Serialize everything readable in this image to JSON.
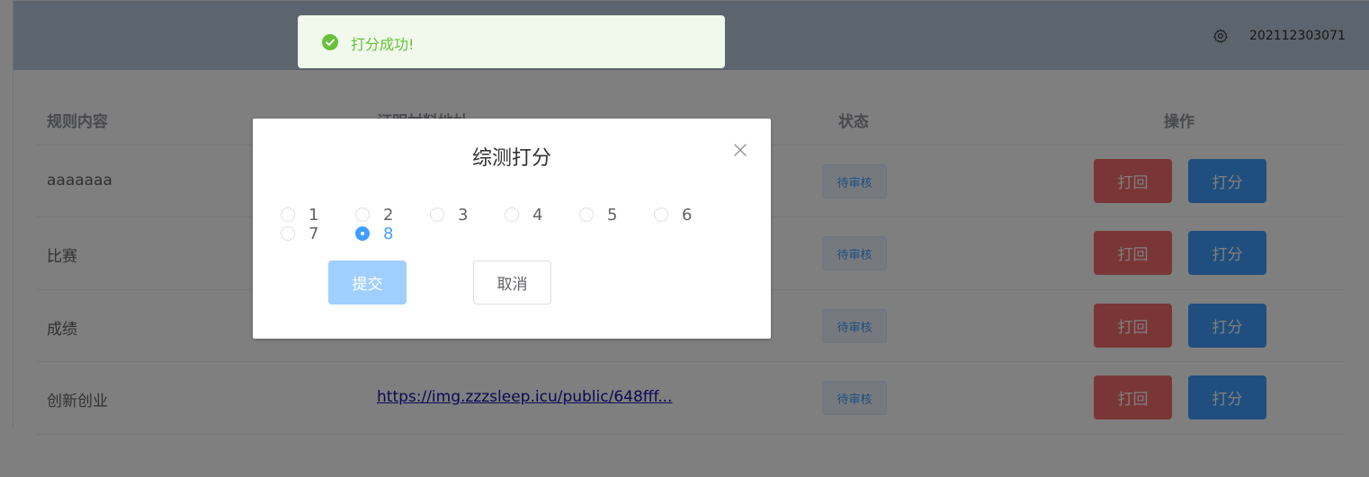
{
  "header": {
    "user_id": "202112303071",
    "settings_icon": "gear-icon"
  },
  "table": {
    "headers": [
      "规则内容",
      "证明材料地址",
      "状态",
      "操作"
    ],
    "rows": [
      {
        "rule": "aaaaaaa",
        "link": "",
        "status": "待审核",
        "reject": "打回",
        "score": "打分"
      },
      {
        "rule": "比赛",
        "link": "",
        "status": "待审核",
        "reject": "打回",
        "score": "打分"
      },
      {
        "rule": "成绩",
        "link": "",
        "status": "待审核",
        "reject": "打回",
        "score": "打分"
      },
      {
        "rule": "创新创业",
        "link": "https://img.zzzsleep.icu/public/648fff...",
        "status": "待审核",
        "reject": "打回",
        "score": "打分"
      }
    ]
  },
  "toast": {
    "message": "打分成功!",
    "icon": "check-circle-icon",
    "color": "#67c23a"
  },
  "dialog": {
    "title": "综测打分",
    "close_icon": "close-icon",
    "options": [
      "1",
      "2",
      "3",
      "4",
      "5",
      "6",
      "7",
      "8"
    ],
    "selected": "8",
    "submit": "提交",
    "cancel": "取消"
  },
  "colors": {
    "primary": "#409eff",
    "danger": "#f56c6c",
    "success": "#67c23a"
  }
}
